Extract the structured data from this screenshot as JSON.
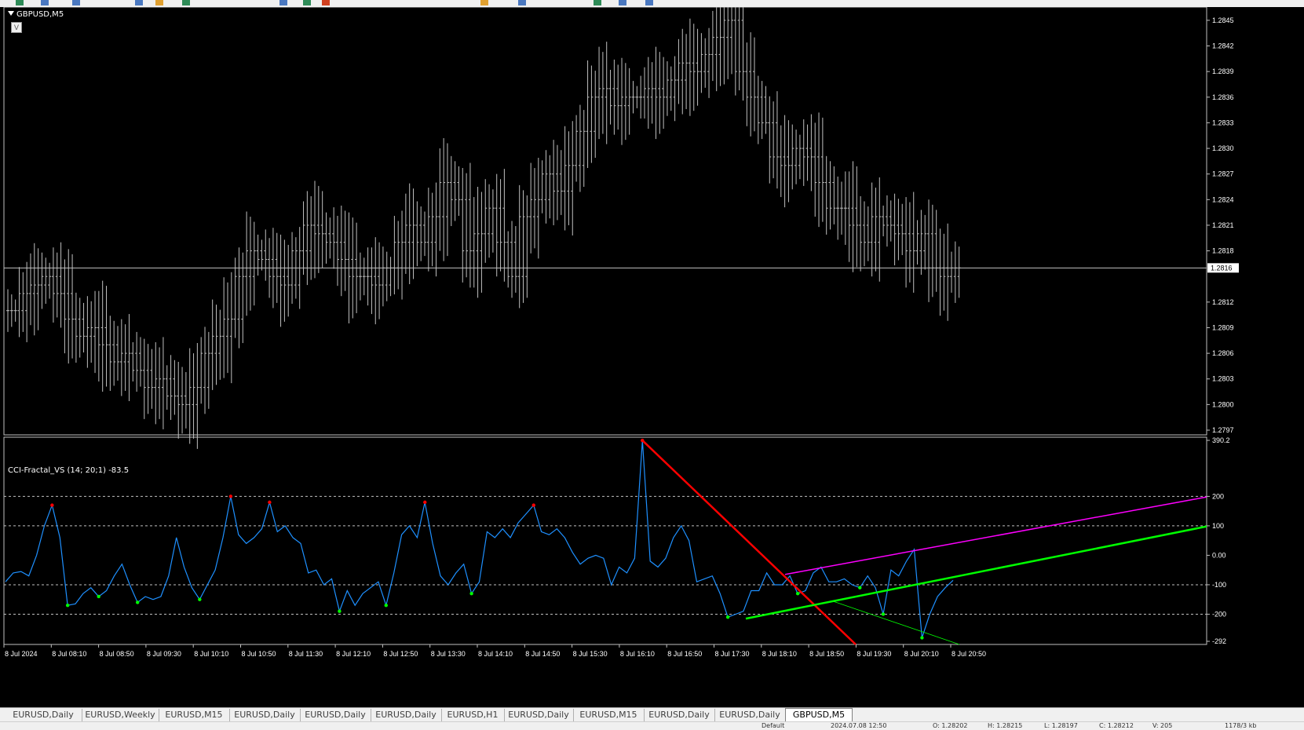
{
  "chart_window": {
    "symbol_title": "GBPUSD,M5",
    "indicator_button": "V",
    "indicator_title": "CCI-Fractal_VS (14; 20;1) -83.5",
    "current_price_label": "1.2816"
  },
  "price_axis": {
    "labels": [
      "1.2845",
      "1.2842",
      "1.2839",
      "1.2836",
      "1.2833",
      "1.2830",
      "1.2827",
      "1.2824",
      "1.2821",
      "1.2818",
      "1.2812",
      "1.2809",
      "1.2806",
      "1.2803",
      "1.2800",
      "1.2797"
    ]
  },
  "indicator_axis": {
    "labels": [
      "390.2",
      "200",
      "100",
      "0.00",
      "-100",
      "-200",
      "-292"
    ]
  },
  "time_axis": {
    "labels": [
      "8 Jul 2024",
      "8 Jul 08:10",
      "8 Jul 08:50",
      "8 Jul 09:30",
      "8 Jul 10:10",
      "8 Jul 10:50",
      "8 Jul 11:30",
      "8 Jul 12:10",
      "8 Jul 12:50",
      "8 Jul 13:30",
      "8 Jul 14:10",
      "8 Jul 14:50",
      "8 Jul 15:30",
      "8 Jul 16:10",
      "8 Jul 16:50",
      "8 Jul 17:30",
      "8 Jul 18:10",
      "8 Jul 18:50",
      "8 Jul 19:30",
      "8 Jul 20:10",
      "8 Jul 20:50"
    ]
  },
  "tabs": [
    {
      "label": "EURUSD,Daily",
      "active": false
    },
    {
      "label": "EURUSD,Weekly",
      "active": false
    },
    {
      "label": "EURUSD,M15",
      "active": false
    },
    {
      "label": "EURUSD,Daily",
      "active": false
    },
    {
      "label": "EURUSD,Daily",
      "active": false
    },
    {
      "label": "EURUSD,Daily",
      "active": false
    },
    {
      "label": "EURUSD,H1",
      "active": false
    },
    {
      "label": "EURUSD,Daily",
      "active": false
    },
    {
      "label": "EURUSD,M15",
      "active": false
    },
    {
      "label": "EURUSD,Daily",
      "active": false
    },
    {
      "label": "EURUSD,Daily",
      "active": false
    },
    {
      "label": "GBPUSD,M5",
      "active": true
    }
  ],
  "status_bar": {
    "profile": "Default",
    "datetime": "2024.07.08 12:50",
    "open": "O: 1.28202",
    "high": "H: 1.28215",
    "low": "L: 1.28197",
    "close": "C: 1.28212",
    "volume": "V: 205",
    "traffic": "1178/3 kb"
  },
  "colors": {
    "background": "#000000",
    "candles": "#c0c0c0",
    "cci_line": "#1e90ff",
    "fractal_up": "#ff0000",
    "fractal_down": "#00ff00",
    "trend_red": "#ff0000",
    "trend_magenta": "#ff00ff",
    "trend_green": "#00ff00"
  },
  "chart_data": {
    "type": "line",
    "price_series": {
      "name": "GBPUSD,M5",
      "close": [
        1.2811,
        1.2813,
        1.2814,
        1.2815,
        1.2813,
        1.281,
        1.2808,
        1.2809,
        1.2807,
        1.2805,
        1.2806,
        1.2804,
        1.2802,
        1.2803,
        1.2801,
        1.28,
        1.2802,
        1.2806,
        1.2808,
        1.281,
        1.2815,
        1.2818,
        1.2817,
        1.2815,
        1.2814,
        1.2818,
        1.2821,
        1.282,
        1.2819,
        1.2817,
        1.2815,
        1.2815,
        1.2814,
        1.2816,
        1.2819,
        1.2821,
        1.2819,
        1.2822,
        1.2826,
        1.2824,
        1.2818,
        1.282,
        1.2823,
        1.2819,
        1.2815,
        1.2822,
        1.2824,
        1.2827,
        1.2825,
        1.2828,
        1.2832,
        1.2836,
        1.2837,
        1.2835,
        1.2836,
        1.2836,
        1.2837,
        1.2836,
        1.2838,
        1.284,
        1.2839,
        1.2841,
        1.2843,
        1.2845,
        1.2839,
        1.2836,
        1.2833,
        1.2829,
        1.2828,
        1.283,
        1.2829,
        1.2826,
        1.2823,
        1.2823,
        1.2821,
        1.2819,
        1.2822,
        1.2821,
        1.282,
        1.2818,
        1.282,
        1.2816,
        1.2815,
        1.2816
      ],
      "ylim": [
        1.2797,
        1.2846
      ]
    },
    "cci_series": {
      "name": "CCI-Fractal_VS (14; 20;1)",
      "values": [
        -90,
        -60,
        -55,
        -70,
        0,
        100,
        170,
        60,
        -170,
        -165,
        -130,
        -110,
        -140,
        -120,
        -70,
        -30,
        -100,
        -160,
        -140,
        -150,
        -140,
        -70,
        60,
        -40,
        -110,
        -150,
        -100,
        -50,
        60,
        200,
        70,
        40,
        60,
        90,
        180,
        80,
        100,
        60,
        40,
        -60,
        -50,
        -100,
        -80,
        -190,
        -120,
        -170,
        -130,
        -110,
        -90,
        -170,
        -60,
        70,
        100,
        60,
        180,
        40,
        -70,
        -100,
        -60,
        -30,
        -130,
        -90,
        80,
        60,
        90,
        60,
        110,
        140,
        170,
        80,
        70,
        90,
        60,
        10,
        -30,
        -10,
        0,
        -10,
        -100,
        -40,
        -60,
        -10,
        390,
        -20,
        -40,
        -10,
        60,
        100,
        50,
        -90,
        -80,
        -70,
        -130,
        -210,
        -200,
        -190,
        -120,
        -120,
        -60,
        -100,
        -100,
        -70,
        -130,
        -120,
        -60,
        -40,
        -90,
        -90,
        -80,
        -100,
        -110,
        -70,
        -110,
        -200,
        -50,
        -70,
        -20,
        20,
        -280,
        -200,
        -140,
        -110,
        -85
      ],
      "ylim": [
        -292,
        390.2
      ],
      "levels": [
        200,
        100,
        -100,
        -200
      ]
    }
  }
}
